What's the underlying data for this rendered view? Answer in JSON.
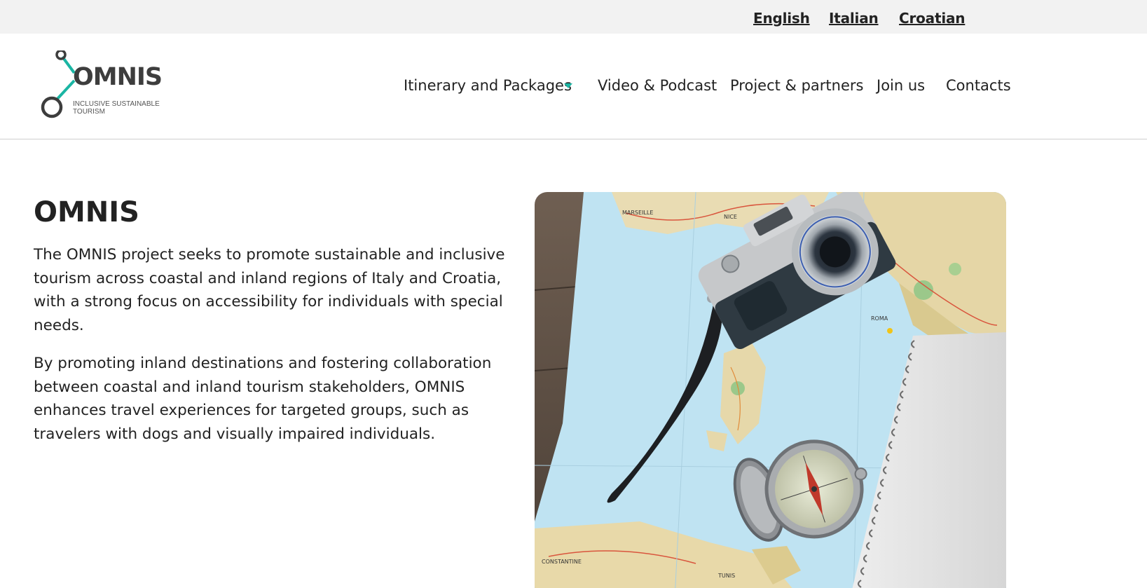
{
  "languages": {
    "english": "English",
    "italian": "Italian",
    "croatian": "Croatian"
  },
  "logo": {
    "word": "OMNIS",
    "tagline": "INCLUSIVE SUSTAINABLE TOURISM"
  },
  "nav": {
    "itinerary": "Itinerary and Packages",
    "video": "Video & Podcast",
    "project": "Project & partners",
    "join": "Join us",
    "contacts": "Contacts"
  },
  "main": {
    "title": "OMNIS",
    "paragraph1": "The OMNIS project seeks to promote sustainable and inclusive tourism across coastal and inland regions of Italy and Croatia, with a strong focus on accessibility for individuals with special needs.",
    "paragraph2": "By promoting inland destinations and fostering collaboration between coastal and inland tourism stakeholders, OMNIS enhances travel experiences for targeted groups, such as travelers with dogs and visually impaired individuals."
  },
  "hero_image": {
    "map_labels": [
      "MARSEILLE",
      "NICE",
      "ROMA",
      "CONSTANTINE",
      "TUNIS"
    ]
  },
  "colors": {
    "accent": "#1ab5a3",
    "topbar": "#f2f2f2",
    "text": "#222222",
    "logo_text": "#3d3d3d"
  }
}
